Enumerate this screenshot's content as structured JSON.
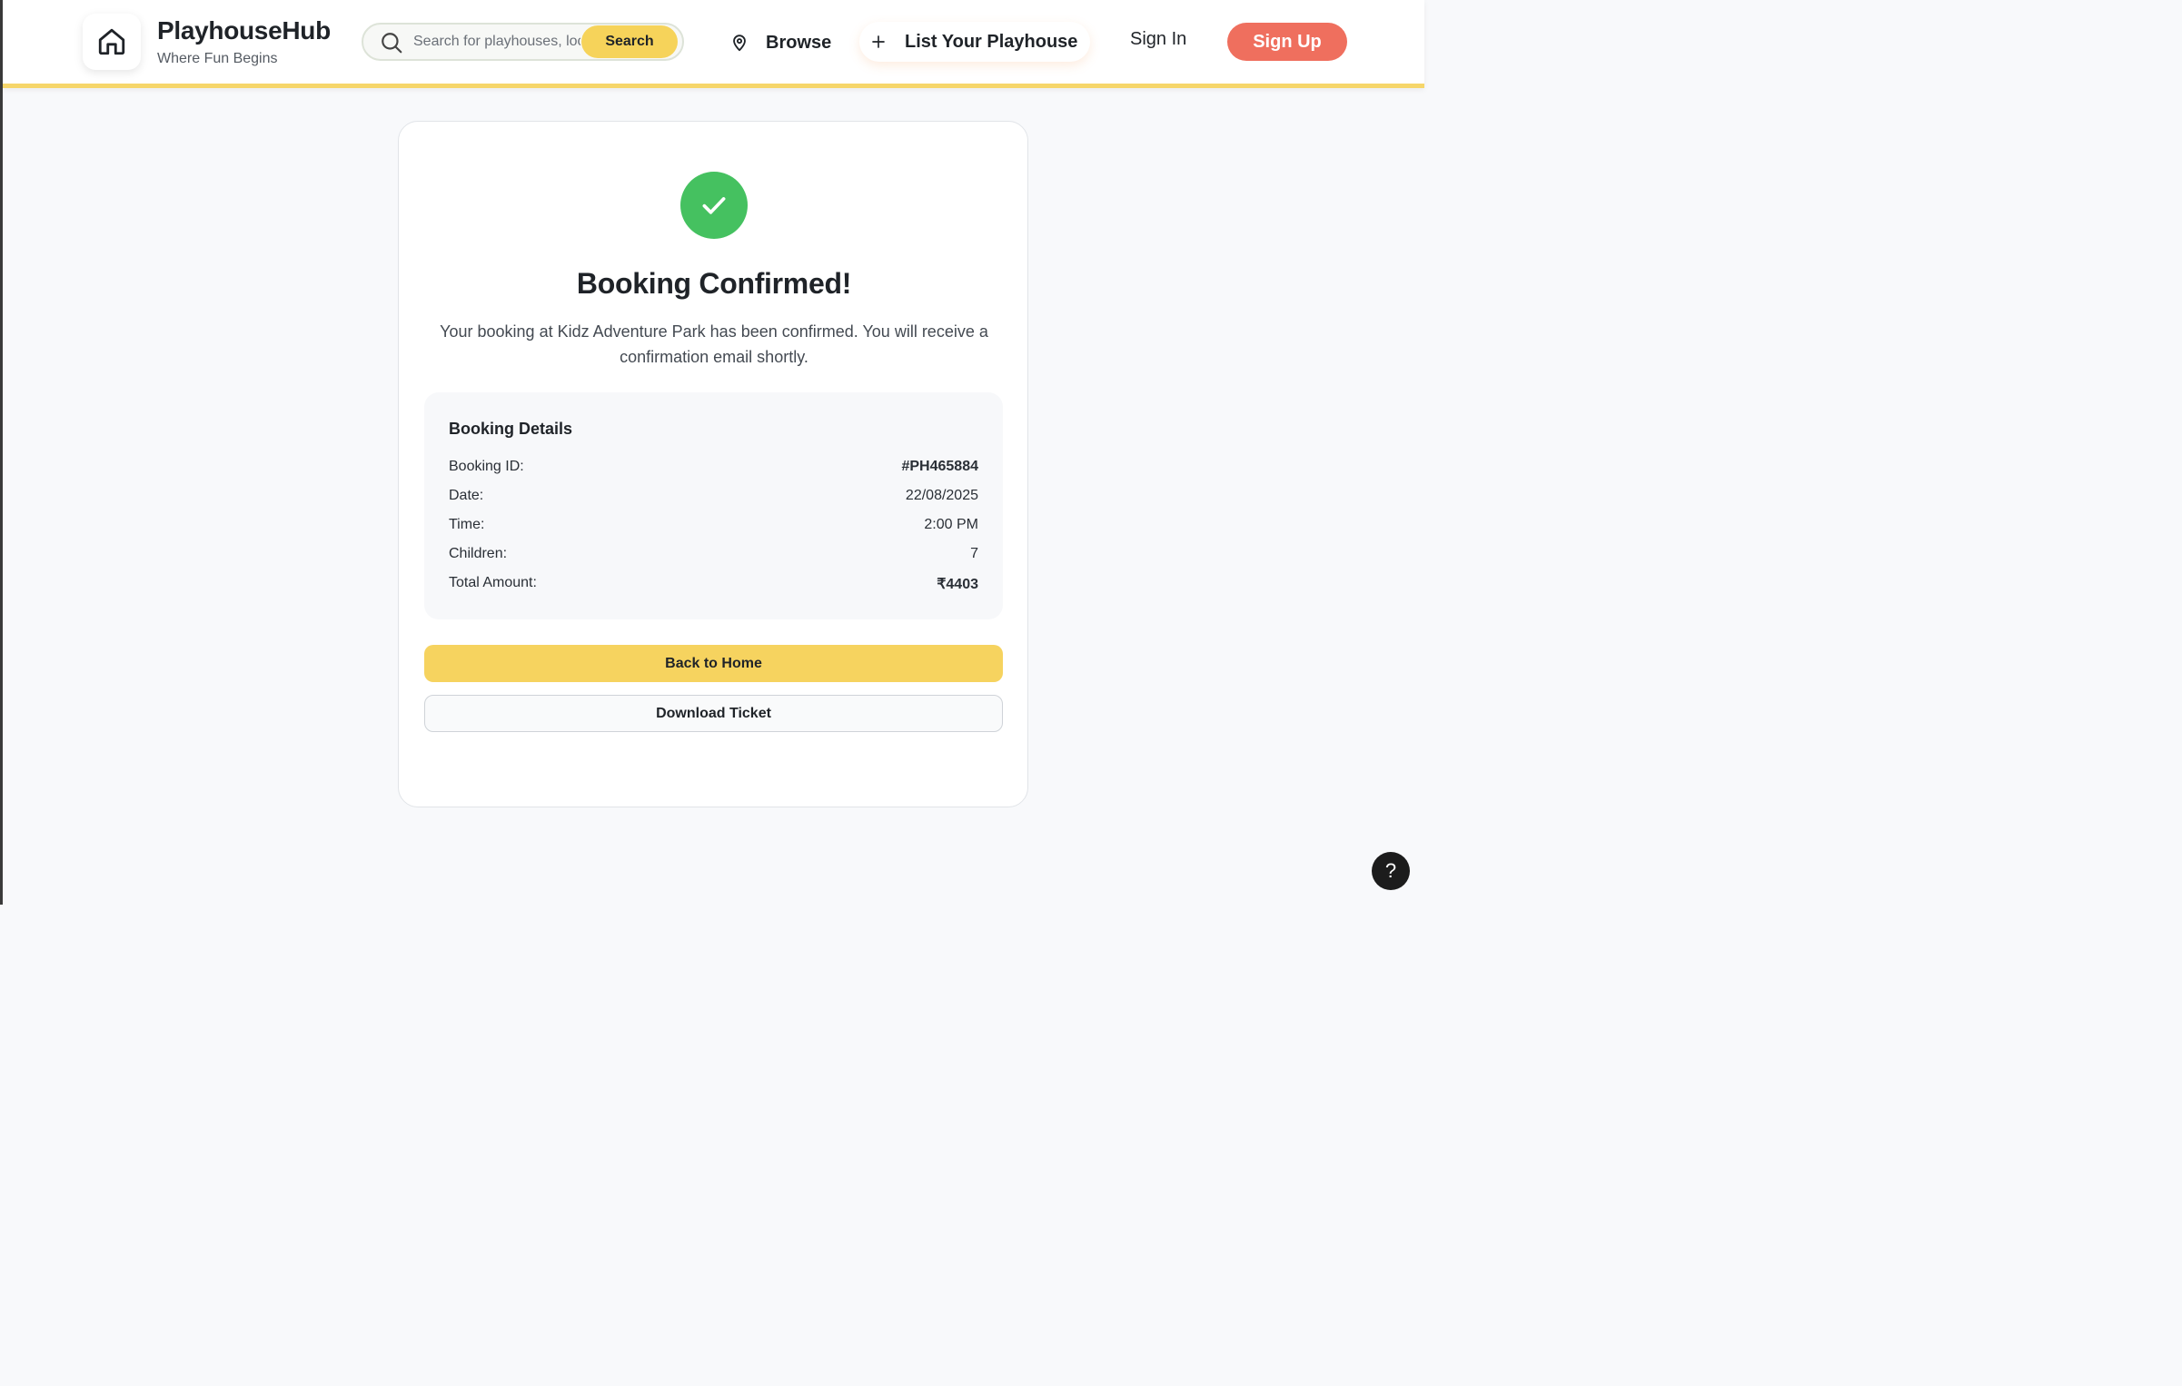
{
  "brand": {
    "name": "PlayhouseHub",
    "tagline": "Where Fun Begins"
  },
  "search": {
    "placeholder": "Search for playhouses, locations...",
    "button_label": "Search"
  },
  "nav": {
    "browse_label": "Browse",
    "list_label": "List Your Playhouse",
    "signin_label": "Sign In",
    "signup_label": "Sign Up"
  },
  "confirmation": {
    "title": "Booking Confirmed!",
    "message": "Your booking at Kidz Adventure Park has been confirmed. You will receive a confirmation email shortly."
  },
  "details": {
    "title": "Booking Details",
    "rows": [
      {
        "label": "Booking ID:",
        "value": "#PH465884"
      },
      {
        "label": "Date:",
        "value": "22/08/2025"
      },
      {
        "label": "Time:",
        "value": "2:00 PM"
      },
      {
        "label": "Children:",
        "value": "7"
      },
      {
        "label": "Total Amount:",
        "value": "₹4403"
      }
    ]
  },
  "actions": {
    "home_label": "Back to Home",
    "download_label": "Download Ticket"
  },
  "help": {
    "label": "?"
  },
  "colors": {
    "accent_yellow": "#f6d35a",
    "signup_coral": "#ef6f5e",
    "success_green": "#45c160"
  },
  "icons": {
    "logo": "home-icon",
    "search": "search-icon",
    "browse": "map-pin-icon",
    "list": "plus-icon",
    "success": "check-icon"
  }
}
